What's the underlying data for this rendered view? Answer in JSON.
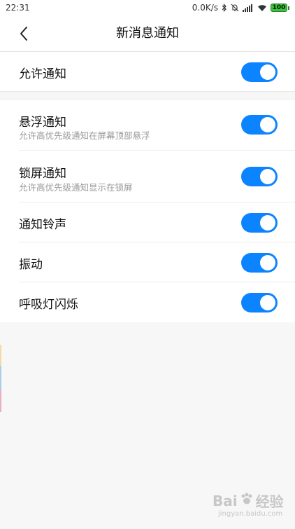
{
  "status_bar": {
    "time": "22:31",
    "net_speed": "0.0K/s",
    "battery": "100",
    "icons": [
      "bluetooth-icon",
      "mute-icon",
      "signal-icon",
      "wifi-icon",
      "battery-icon"
    ]
  },
  "header": {
    "title": "新消息通知",
    "back_icon": "chevron-left-icon"
  },
  "settings": {
    "allow": {
      "title": "允许通知",
      "enabled": true
    },
    "items": [
      {
        "title": "悬浮通知",
        "subtitle": "允许高优先级通知在屏幕顶部悬浮",
        "enabled": true
      },
      {
        "title": "锁屏通知",
        "subtitle": "允许高优先级通知显示在锁屏",
        "enabled": true
      },
      {
        "title": "通知铃声",
        "enabled": true
      },
      {
        "title": "振动",
        "enabled": true
      },
      {
        "title": "呼吸灯闪烁",
        "enabled": true
      }
    ]
  },
  "colors": {
    "toggle_on": "#0d84ff",
    "background": "#f7f7f7"
  },
  "watermark": {
    "brand": "Bai",
    "brand_cn": "经验",
    "url": "jingyan.baidu.com"
  }
}
